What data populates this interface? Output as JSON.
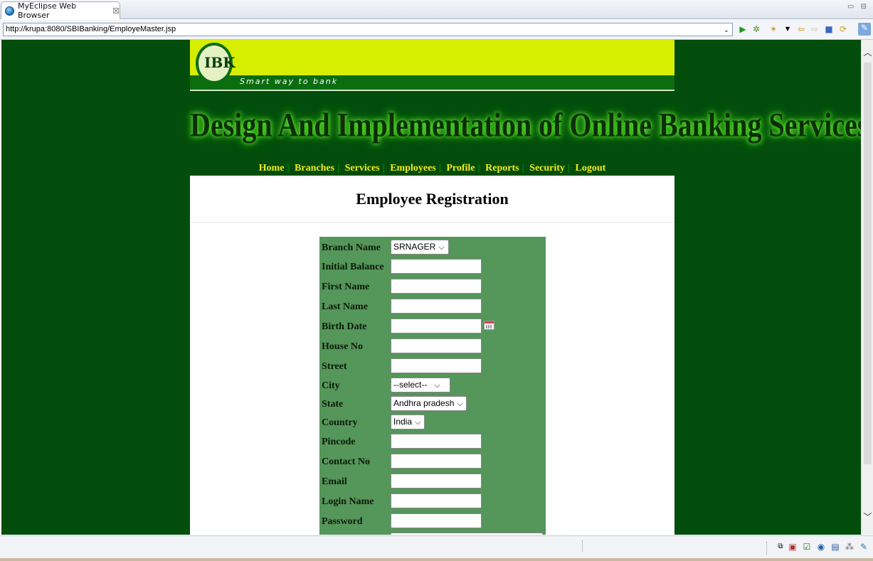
{
  "window": {
    "tab_title": "MyEclipse Web Browser",
    "close_glyph": "☒",
    "view_controls": "▭ ⊟"
  },
  "browser": {
    "url": "http://krupa:8080/SBIBanking/EmployeMaster.jsp",
    "icons": [
      "dropdown-icon",
      "run-icon",
      "debug-icon",
      "tools-icon",
      "back-icon",
      "forward-icon",
      "stop-icon",
      "refresh-icon",
      "edit-icon"
    ]
  },
  "site": {
    "logo_text": "IBK",
    "tagline": "Smart way to bank",
    "headline": "Design And Implementation of  Online Banking Services",
    "nav": [
      "Home",
      "Branches",
      "Services",
      "Employees",
      "Profile",
      "Reports",
      "Security",
      "Logout"
    ]
  },
  "form": {
    "title": "Employee Registration",
    "fields": {
      "branch_name": {
        "label": "Branch Name",
        "value": "SRNAGER"
      },
      "initial_balance": {
        "label": "Initial Balance",
        "value": ""
      },
      "first_name": {
        "label": "First Name",
        "value": ""
      },
      "last_name": {
        "label": "Last Name",
        "value": ""
      },
      "birth_date": {
        "label": "Birth Date",
        "value": ""
      },
      "house_no": {
        "label": "House No",
        "value": ""
      },
      "street": {
        "label": "Street",
        "value": ""
      },
      "city": {
        "label": "City",
        "value": "--select--"
      },
      "state": {
        "label": "State",
        "value": "Andhra pradesh"
      },
      "country": {
        "label": "Country",
        "value": "India"
      },
      "pincode": {
        "label": "Pincode",
        "value": ""
      },
      "contact_no": {
        "label": "Contact No",
        "value": ""
      },
      "email": {
        "label": "Email",
        "value": ""
      },
      "login_name": {
        "label": "Login Name",
        "value": ""
      },
      "password": {
        "label": "Password",
        "value": ""
      }
    }
  },
  "colors": {
    "page_bg": "#024d0b",
    "banner_yellow": "#d6ee00",
    "banner_green": "#0b6d10",
    "nav_text": "#f2ec14",
    "form_panel": "#55965a"
  }
}
